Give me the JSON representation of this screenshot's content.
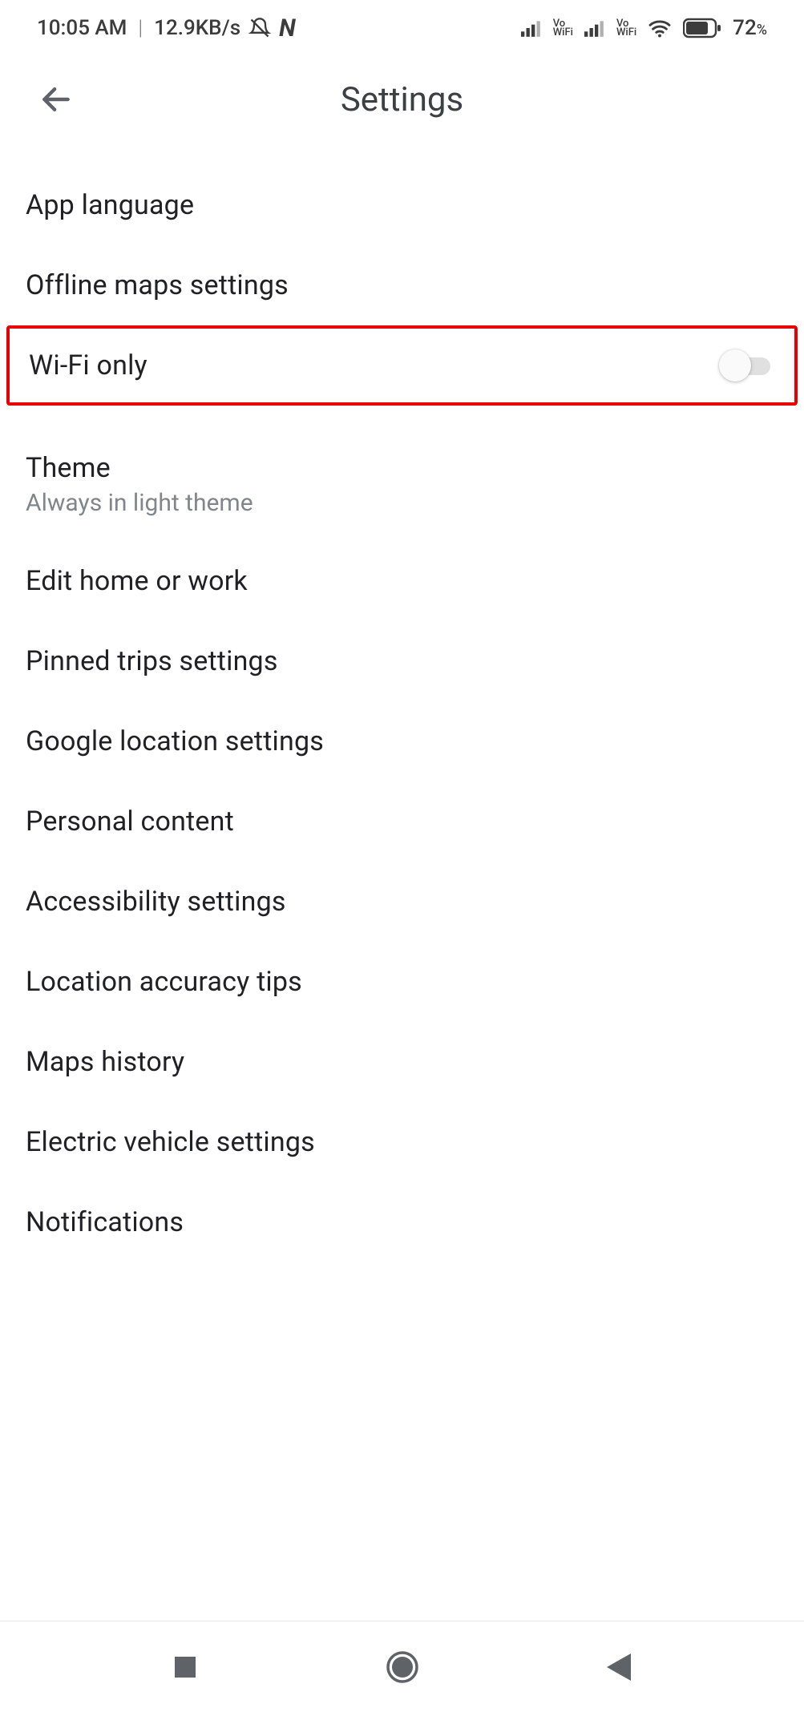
{
  "statusbar": {
    "time": "10:05 AM",
    "data_rate": "12.9KB/s",
    "vowifi_label": "Vo\nWiFi",
    "battery_text": "72",
    "battery_pct": "%"
  },
  "appbar": {
    "title": "Settings"
  },
  "rows": {
    "app_language": "App language",
    "offline_maps": "Offline maps settings",
    "wifi_only": "Wi-Fi only",
    "theme_title": "Theme",
    "theme_sub": "Always in light theme",
    "edit_home_work": "Edit home or work",
    "pinned_trips": "Pinned trips settings",
    "google_location": "Google location settings",
    "personal_content": "Personal content",
    "accessibility": "Accessibility settings",
    "location_tips": "Location accuracy tips",
    "maps_history": "Maps history",
    "ev_settings": "Electric vehicle settings",
    "notifications": "Notifications"
  },
  "switches": {
    "wifi_only_on": false
  },
  "highlight_row": "wifi_only"
}
